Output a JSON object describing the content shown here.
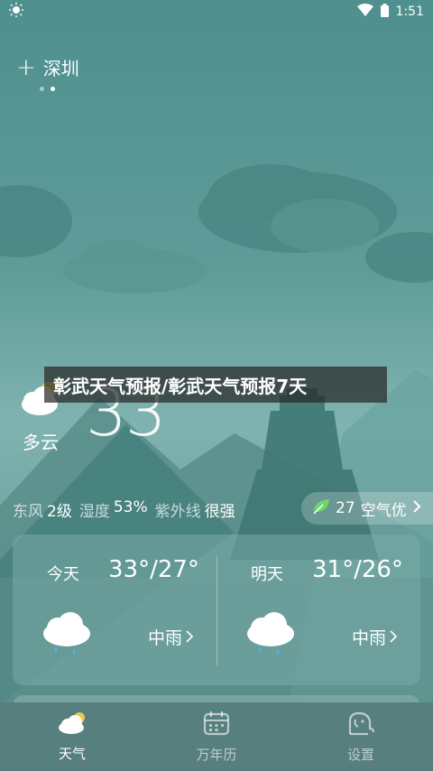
{
  "status_bar": {
    "time": "1:51"
  },
  "location": {
    "city": "深圳",
    "add_icon": "plus-icon",
    "pages": 2,
    "active_page": 1
  },
  "headline": "彰武天气预报/彰武天气预报7天",
  "current": {
    "temperature": "33",
    "condition": "多云",
    "condition_icon": "partly-cloudy-icon"
  },
  "stats": {
    "wind_label": "东风",
    "wind_value": "2级",
    "humidity_label": "湿度",
    "humidity_value": "53%",
    "uv_label": "紫外线",
    "uv_value": "很强"
  },
  "aqi": {
    "value": "27",
    "label": "空气优",
    "icon": "leaf-icon"
  },
  "forecast": [
    {
      "day": "今天",
      "range": "33°/27°",
      "condition": "中雨",
      "icon": "rain-cloud-icon"
    },
    {
      "day": "明天",
      "range": "31°/26°",
      "condition": "中雨",
      "icon": "rain-cloud-icon"
    }
  ],
  "nav": [
    {
      "label": "天气",
      "icon": "weather-icon",
      "active": true
    },
    {
      "label": "万年历",
      "icon": "calendar-icon",
      "active": false
    },
    {
      "label": "设置",
      "icon": "elephant-icon",
      "active": false
    }
  ],
  "colors": {
    "accent_green": "#6fd66a",
    "nav_bg": "#577f7d",
    "bg_top": "#4f8f8d"
  }
}
